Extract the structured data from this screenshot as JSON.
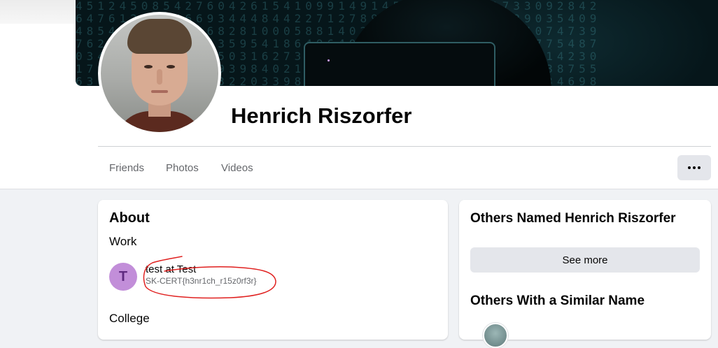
{
  "profile": {
    "name": "Henrich Riszorfer"
  },
  "tabs": [
    {
      "label": "Friends"
    },
    {
      "label": "Photos"
    },
    {
      "label": "Videos"
    }
  ],
  "about": {
    "title": "About",
    "work_heading": "Work",
    "work": {
      "avatar_letter": "T",
      "position": "test",
      "connector": " at ",
      "employer": "Test",
      "description": "SK-CERT{h3nr1ch_r15z0rf3r}"
    },
    "college_heading": "College"
  },
  "sidebar": {
    "others_named_title": "Others Named Henrich Riszorfer",
    "see_more_label": "See more",
    "similar_name_title": "Others With a Similar Name"
  },
  "icons": {
    "more": "more-horizontal-icon"
  },
  "colors": {
    "annotation": "#e0201f",
    "work_avatar_bg": "#c28ed9"
  }
}
